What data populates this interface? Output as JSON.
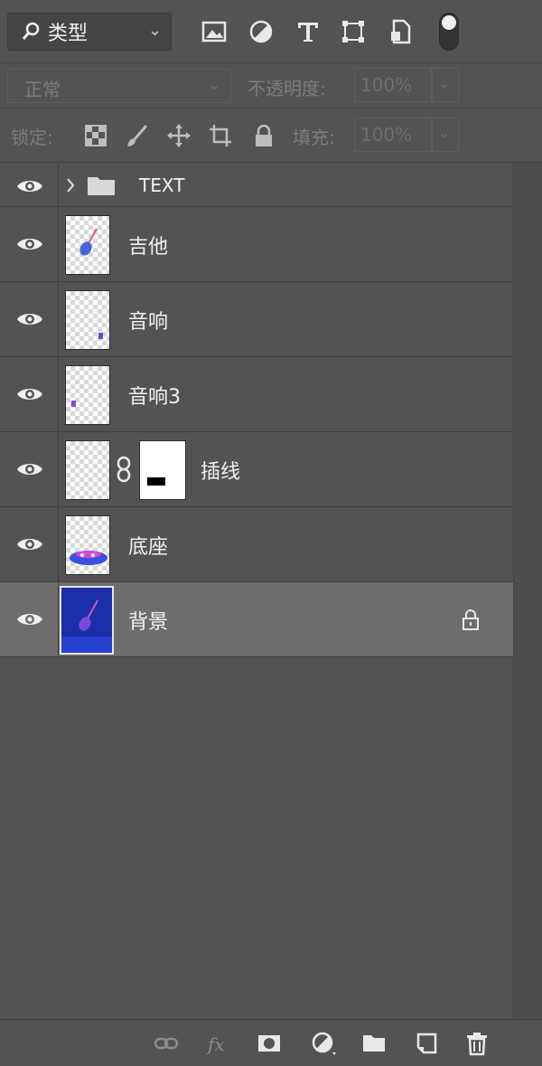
{
  "filter": {
    "kind_label": "类型",
    "icons": [
      "image-filter-icon",
      "adjustment-filter-icon",
      "type-filter-icon",
      "shape-filter-icon",
      "smart-object-filter-icon"
    ]
  },
  "blend": {
    "mode": "正常",
    "opacity_label": "不透明度:",
    "opacity_value": "100%"
  },
  "lock": {
    "label": "锁定:",
    "fill_label": "填充:",
    "fill_value": "100%"
  },
  "layers": [
    {
      "name": "TEXT",
      "type": "group"
    },
    {
      "name": "吉他",
      "type": "pixel"
    },
    {
      "name": "音响",
      "type": "pixel"
    },
    {
      "name": "音响3",
      "type": "pixel"
    },
    {
      "name": "插线",
      "type": "pixel-with-mask"
    },
    {
      "name": "底座",
      "type": "pixel"
    },
    {
      "name": "背景",
      "type": "background",
      "selected": true,
      "locked": true
    }
  ],
  "bottom_icons": [
    "link-layers-icon",
    "fx-icon",
    "add-mask-icon",
    "adjustment-layer-icon",
    "new-group-icon",
    "new-layer-icon",
    "trash-icon"
  ],
  "colors": {
    "panel_bg": "#535353",
    "selected_row": "#6d6d6d",
    "background_thumb": "#1a2fa8"
  }
}
